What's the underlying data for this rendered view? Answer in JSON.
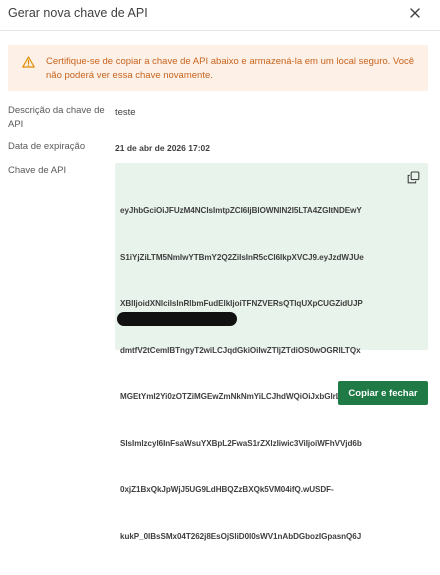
{
  "dialog": {
    "title": "Gerar nova chave de API",
    "close_icon": "close-icon"
  },
  "alert": {
    "icon": "warning-icon",
    "line1": "Certifique-se de copiar a chave de API abaixo e armazená-la em um local seguro. Você",
    "line2": "não poderá ver essa chave novamente.",
    "color": "#c8641e",
    "background": "#fdf0e6"
  },
  "fields": {
    "description_label_line1": "Descrição da chave de",
    "description_label_line2": "API",
    "description_value": "teste",
    "expiration_label": "Data de expiração",
    "expiration_value": "21 de abr de 2026 17:02",
    "key_label": "Chave de API"
  },
  "api_key": {
    "lines": [
      "eyJhbGciOiJFUzM4NCIsImtpZCI6IjBlOWNlN2I5LTA4ZGItNDEwY",
      "S1iYjZiLTM5NmIwYTBmY2Q2ZiIsInR5cCI6IkpXVCJ9.eyJzdWJUe",
      "XBlIjoidXNlcilsInRlbmFudElkIjoiTFNZVERsQTlqUXpCUGZidUJP",
      "dmtfV2tCemlBTngyT2wiLCJqdGkiOiIwZTljZTdiOS0wOGRlLTQx",
      "MGEtYmI2Yi0zOTZiMGEwZmNkNmYiLCJhdWQiOiJxbGlrLmFwa",
      "SIsImlzcyI6InFsaWsuYXBpL2FwaS1rZXlzIiwic3ViIjoiWFhVVjd6b",
      "0xjZ1BxQkJpWjJ5UG9LdHBQZzBXQk5VM04ifQ.wUSDF-",
      "kukP_0lBsSMx04T262j8EsOjSliD0l0sWV1nAbDGbozIGpasnQ6J"
    ],
    "copy_icon": "copy-icon",
    "background": "#e8f3ec"
  },
  "actions": {
    "primary_label": "Copiar e fechar",
    "primary_color": "#1f7a45"
  }
}
